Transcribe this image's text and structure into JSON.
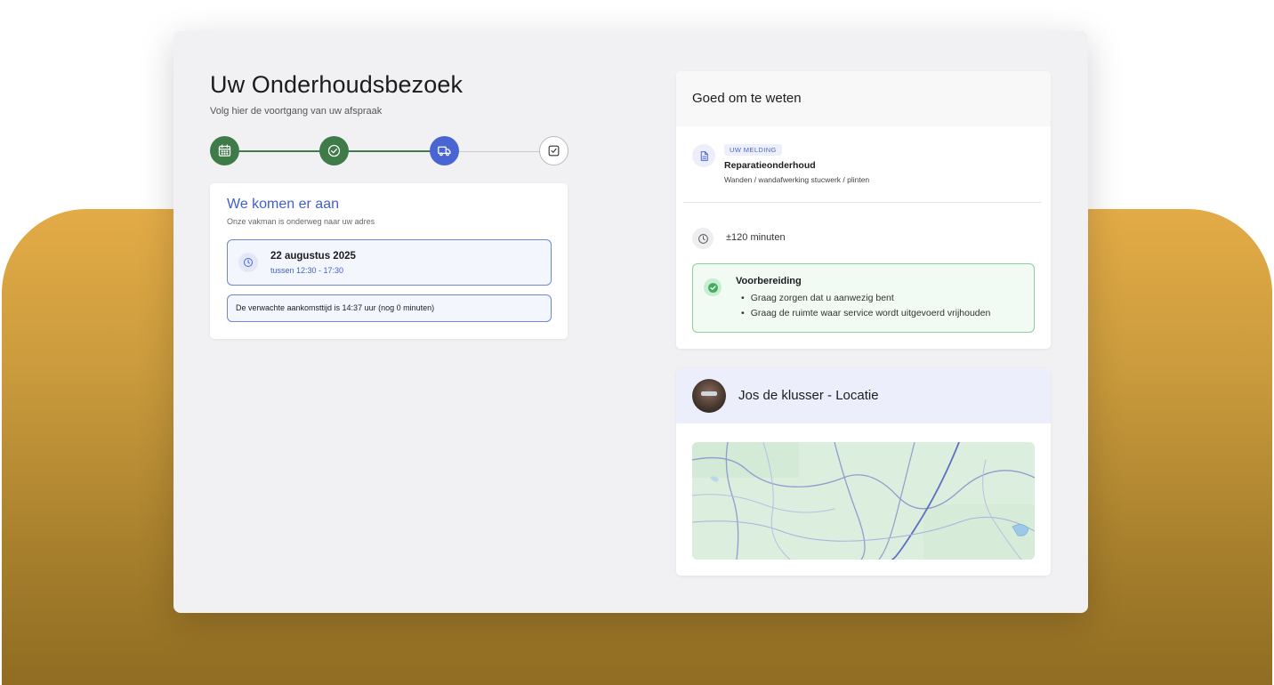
{
  "page": {
    "title": "Uw Onderhoudsbezoek",
    "subtitle": "Volg hier de voortgang van uw afspraak"
  },
  "stepper": {
    "steps": [
      {
        "icon": "calendar-icon",
        "state": "done"
      },
      {
        "icon": "check-circle-icon",
        "state": "done"
      },
      {
        "icon": "truck-icon",
        "state": "active"
      },
      {
        "icon": "checkbox-icon",
        "state": "todo"
      }
    ],
    "colors": {
      "done": "#3e7b48",
      "active": "#4965d3",
      "todo": "#b8b8bd"
    }
  },
  "arrival": {
    "title": "We komen er aan",
    "subtitle": "Onze vakman is onderweg naar uw adres",
    "date": "22 augustus 2025",
    "time_window": "tussen 12:30 - 17:30",
    "eta_text": "De verwachte aankomsttijd is 14:37 uur (nog 0 minuten)"
  },
  "info": {
    "title": "Goed om te weten",
    "melding_tag": "UW MELDING",
    "melding_title": "Reparatieonderhoud",
    "melding_desc": "Wanden / wandafwerking stucwerk / plinten",
    "duration": "±120 minuten",
    "preparation": {
      "title": "Voorbereiding",
      "items": [
        "Graag zorgen dat u aanwezig bent",
        "Graag de ruimte waar service wordt uitgevoerd vrijhouden"
      ]
    }
  },
  "location": {
    "title": "Jos de klusser - Locatie"
  },
  "colors": {
    "accent": "#4965d3",
    "success": "#3e7b48",
    "background_gold": "#e3ab47"
  }
}
